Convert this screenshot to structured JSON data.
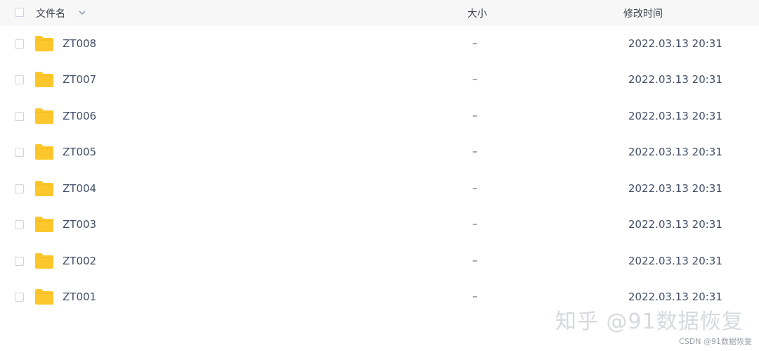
{
  "header": {
    "col_name": "文件名",
    "col_size": "大小",
    "col_mtime": "修改时间"
  },
  "rows": [
    {
      "name": "ZT008",
      "size": "–",
      "mtime": "2022.03.13 20:31"
    },
    {
      "name": "ZT007",
      "size": "–",
      "mtime": "2022.03.13 20:31"
    },
    {
      "name": "ZT006",
      "size": "–",
      "mtime": "2022.03.13 20:31"
    },
    {
      "name": "ZT005",
      "size": "–",
      "mtime": "2022.03.13 20:31"
    },
    {
      "name": "ZT004",
      "size": "–",
      "mtime": "2022.03.13 20:31"
    },
    {
      "name": "ZT003",
      "size": "–",
      "mtime": "2022.03.13 20:31"
    },
    {
      "name": "ZT002",
      "size": "–",
      "mtime": "2022.03.13 20:31"
    },
    {
      "name": "ZT001",
      "size": "–",
      "mtime": "2022.03.13 20:31"
    }
  ],
  "watermark": "知乎 @91数据恢复",
  "credit": "CSDN @91数据恢复",
  "colors": {
    "folder": "#fcc72d",
    "header_bg": "#f7f7f8"
  },
  "icons": {
    "folder": "folder-icon",
    "chevron": "chevron-down-icon"
  }
}
